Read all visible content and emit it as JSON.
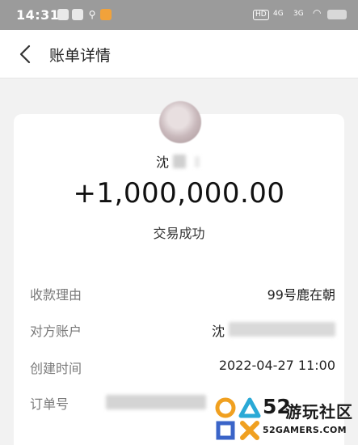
{
  "status_bar": {
    "time": "14:31",
    "hd": "HD",
    "sig1": "4G",
    "sig2": "3G"
  },
  "nav": {
    "title": "账单详情"
  },
  "transaction": {
    "name_visible": "沈",
    "amount": "+1,000,000.00",
    "status": "交易成功"
  },
  "details": {
    "reason_label": "收款理由",
    "reason_value": "99号鹿在朝",
    "account_label": "对方账户",
    "account_value_visible": "沈",
    "created_label": "创建时间",
    "created_value": "2022-04-27 11:00",
    "order_label": "订单号"
  },
  "watermark": {
    "num": "52",
    "cn": "游玩社区",
    "url": "52GAMERS.COM"
  },
  "colors": {
    "status_bar_bg": "#9b9b9b",
    "page_bg": "#f2f2f2",
    "card_bg": "#ffffff",
    "label_gray": "#7a7a7a"
  }
}
